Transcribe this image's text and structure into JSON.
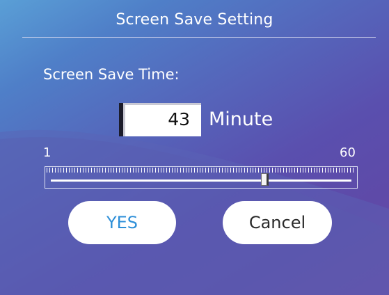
{
  "dialog": {
    "title": "Screen Save Setting",
    "time_label": "Screen Save Time:"
  },
  "timeout": {
    "value": "43",
    "unit": "Minute"
  },
  "slider": {
    "min_label": "1",
    "max_label": "60",
    "min": 1,
    "max": 60,
    "value": 43
  },
  "buttons": {
    "yes_label": "YES",
    "cancel_label": "Cancel"
  },
  "colors": {
    "yes_text": "#2d8fd8",
    "background_top_left": "#5a9fd6",
    "background_bottom_right": "#7048a6"
  }
}
